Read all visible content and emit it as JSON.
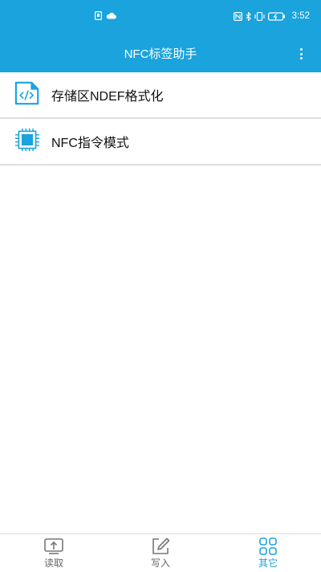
{
  "statusbar": {
    "left_icons": [
      "notification-icon",
      "cloud-icon"
    ],
    "right_icons": [
      "nfc-icon",
      "bluetooth-icon",
      "vibrate-icon",
      "battery-icon"
    ],
    "time": "3:52"
  },
  "appbar": {
    "title": "NFC标签助手",
    "menu_icon": "more-vert-icon"
  },
  "list": {
    "items": [
      {
        "label": "存储区NDEF格式化",
        "icon": "code-file-icon"
      },
      {
        "label": "NFC指令模式",
        "icon": "chip-icon"
      }
    ]
  },
  "tabbar": {
    "tabs": [
      {
        "label": "读取",
        "icon": "read-icon",
        "active": false
      },
      {
        "label": "写入",
        "icon": "write-icon",
        "active": false
      },
      {
        "label": "其它",
        "icon": "grid-icon",
        "active": true
      }
    ]
  },
  "colors": {
    "primary": "#1aa3dd",
    "divider": "#dedede",
    "tab_inactive": "#666666"
  }
}
